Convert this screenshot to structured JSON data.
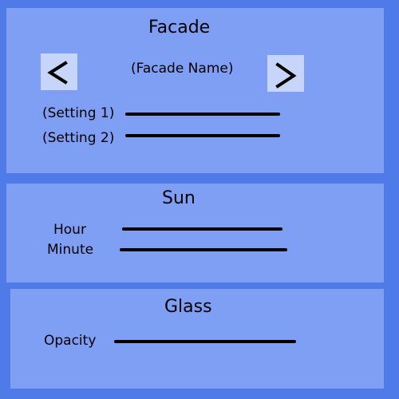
{
  "facade": {
    "title": "Facade",
    "name": "(Facade Name)",
    "prev_icon": "chevron-left-icon",
    "next_icon": "chevron-right-icon",
    "setting1_label": "(Setting 1)",
    "setting2_label": "(Setting 2)"
  },
  "sun": {
    "title": "Sun",
    "hour_label": "Hour",
    "minute_label": "Minute"
  },
  "glass": {
    "title": "Glass",
    "opacity_label": "Opacity"
  },
  "colors": {
    "background": "#4e7be8",
    "panel": "#7f9ff5",
    "button": "#c8d5fb"
  }
}
